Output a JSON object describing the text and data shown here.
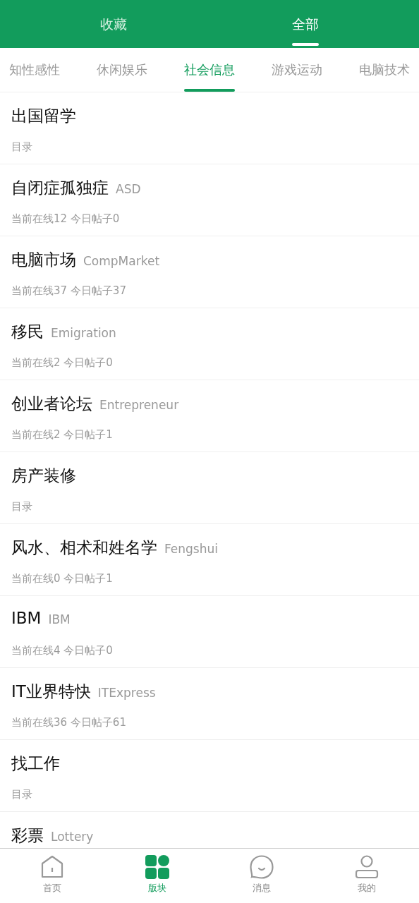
{
  "top_tabs": [
    {
      "label": "收藏",
      "selected": false
    },
    {
      "label": "全部",
      "selected": true
    }
  ],
  "category_tabs": [
    {
      "label": "知性感性",
      "selected": false
    },
    {
      "label": "休闲娱乐",
      "selected": false
    },
    {
      "label": "社会信息",
      "selected": true
    },
    {
      "label": "游戏运动",
      "selected": false
    },
    {
      "label": "电脑技术",
      "selected": false
    }
  ],
  "boards": [
    {
      "title": "出国留学",
      "subtitle": "目录"
    },
    {
      "title": "自闭症孤独症",
      "english": "ASD",
      "subtitle": "当前在线12 今日帖子0"
    },
    {
      "title": "电脑市场",
      "english": "CompMarket",
      "subtitle": "当前在线37 今日帖子37"
    },
    {
      "title": "移民",
      "english": "Emigration",
      "subtitle": "当前在线2 今日帖子0"
    },
    {
      "title": "创业者论坛",
      "english": "Entrepreneur",
      "subtitle": "当前在线2 今日帖子1"
    },
    {
      "title": "房产装修",
      "subtitle": "目录"
    },
    {
      "title": "风水、相术和姓名学",
      "english": "Fengshui",
      "subtitle": "当前在线0 今日帖子1"
    },
    {
      "title": "IBM",
      "english": "IBM",
      "subtitle": "当前在线4 今日帖子0"
    },
    {
      "title": "IT业界特快",
      "english": "ITExpress",
      "subtitle": "当前在线36 今日帖子61"
    },
    {
      "title": "找工作",
      "subtitle": "目录"
    },
    {
      "title": "彩票",
      "english": "Lottery"
    }
  ],
  "bottom_nav": [
    {
      "label": "首页",
      "kind": "home",
      "selected": false
    },
    {
      "label": "版块",
      "kind": "boards",
      "selected": true
    },
    {
      "label": "消息",
      "kind": "messages",
      "selected": false
    },
    {
      "label": "我的",
      "kind": "profile",
      "selected": false
    }
  ]
}
